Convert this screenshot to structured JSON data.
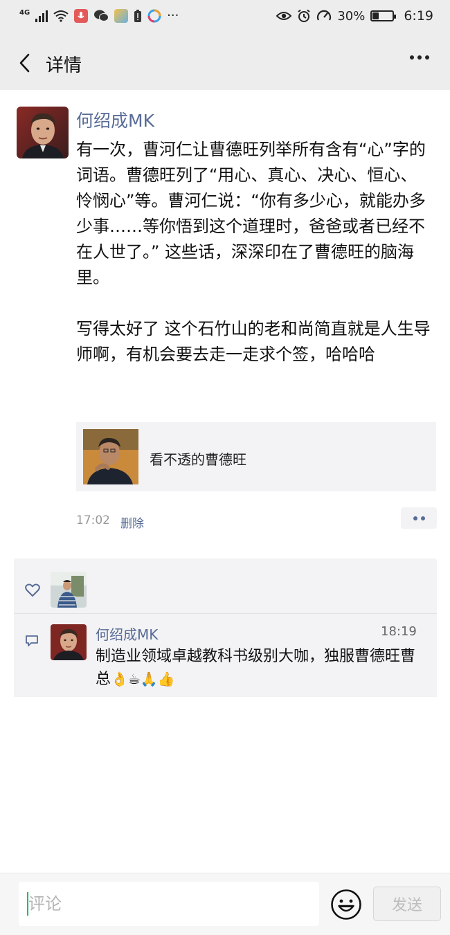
{
  "status_bar": {
    "network": "4G",
    "more": "···",
    "battery_percent": "30%",
    "battery_level": 0.3,
    "time": "6:19"
  },
  "nav": {
    "title": "详情"
  },
  "post": {
    "author": "何绍成MK",
    "text": "有一次，曹河仁让曹德旺列举所有含有“心”字的词语。曹德旺列了“用心、真心、决心、恒心、怜悯心”等。曹河仁说：“你有多少心，就能办多少事……等你悟到这个道理时，爸爸或者已经不在人世了。” 这些话，深深印在了曹德旺的脑海里。\n\n写得太好了 这个石竹山的老和尚简直就是人生导师啊，有机会要去走一走求个签，哈哈哈",
    "link_title": "看不透的曹德旺",
    "time": "17:02",
    "delete_label": "删除"
  },
  "comment": {
    "author": "何绍成MK",
    "time": "18:19",
    "text": "制造业领域卓越教科书级别大咖，独服曹德旺曹总",
    "emojis": [
      "👌",
      "☕",
      "🙏",
      "👍"
    ]
  },
  "input": {
    "placeholder": "评论",
    "send_label": "发送"
  },
  "colors": {
    "link_blue": "#576b95",
    "accent_green": "#07c160",
    "header_gray": "#ededed",
    "panel_gray": "#f3f3f5"
  }
}
